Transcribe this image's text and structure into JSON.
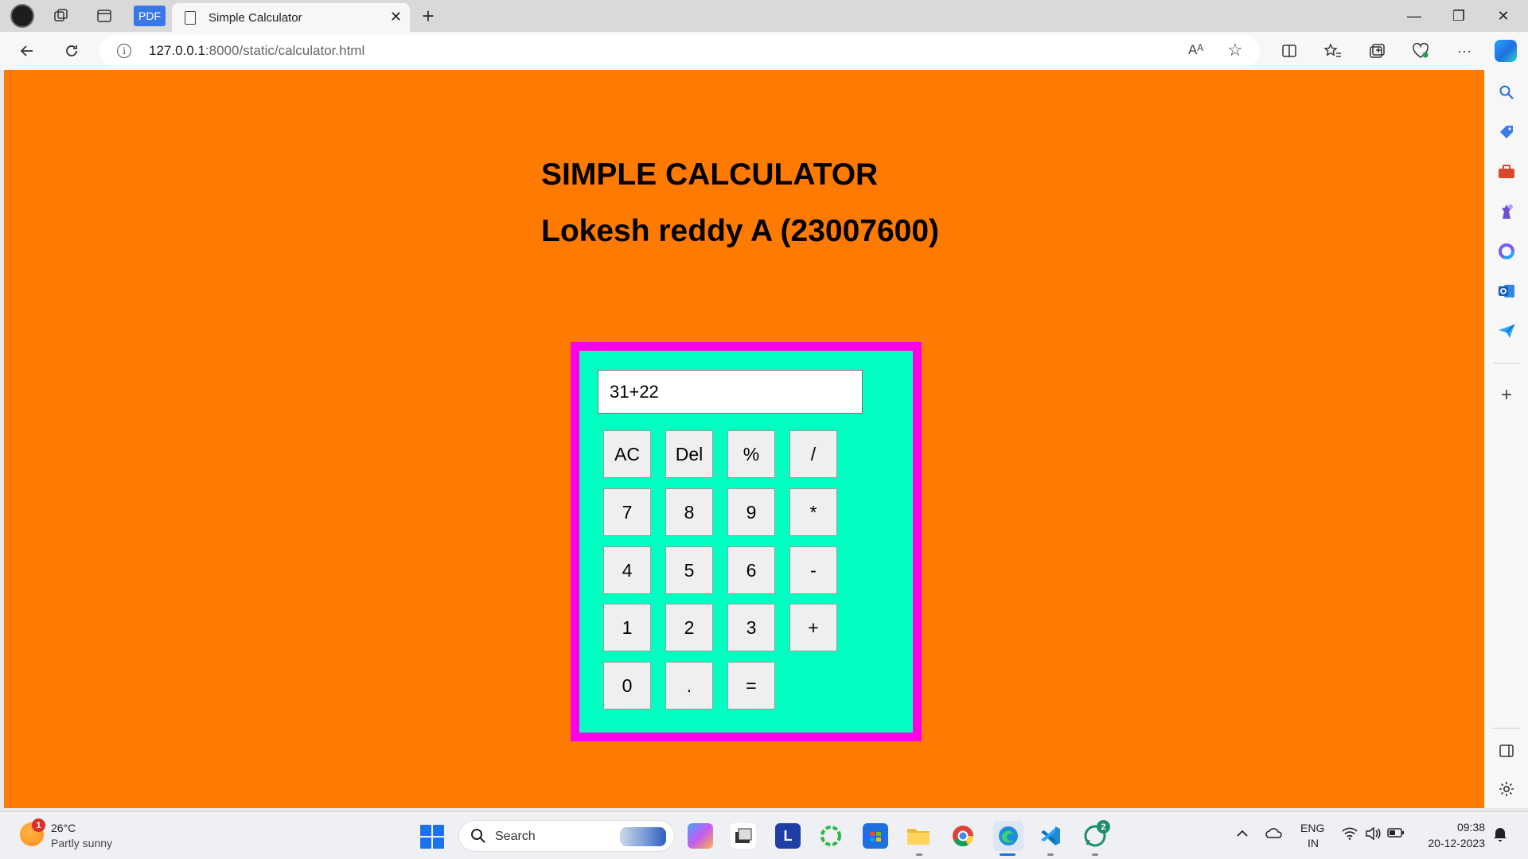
{
  "browser": {
    "tab_title": "Simple Calculator",
    "pdf_label": "PDF",
    "new_tab": "+",
    "close_tab": "✕",
    "window": {
      "minimize": "—",
      "restore": "❐",
      "close": "✕"
    },
    "url_host": "127.0.0.1",
    "url_path": ":8000/static/calculator.html",
    "read_aloud": "Aᴬ",
    "favorite": "☆",
    "more": "···"
  },
  "page": {
    "title": "SIMPLE CALCULATOR",
    "subtitle": "Lokesh reddy A (23007600)",
    "background": "#ff7a00",
    "calculator": {
      "display_value": "31+22",
      "panel_color": "#00ffc0",
      "border_color": "#ff00e6",
      "keys": [
        [
          "AC",
          "Del",
          "%",
          "/"
        ],
        [
          "7",
          "8",
          "9",
          "*"
        ],
        [
          "4",
          "5",
          "6",
          "-"
        ],
        [
          "1",
          "2",
          "3",
          "+"
        ],
        [
          "0",
          ".",
          "="
        ]
      ]
    }
  },
  "sidebar": {
    "add": "+"
  },
  "taskbar": {
    "weather_temp": "26°C",
    "weather_condition": "Partly sunny",
    "weather_badge": "1",
    "search_label": "Search",
    "language_top": "ENG",
    "language_bottom": "IN",
    "time": "09:38",
    "date": "20-12-2023",
    "whatsapp_badge": "2",
    "pinned_letter": "L"
  }
}
